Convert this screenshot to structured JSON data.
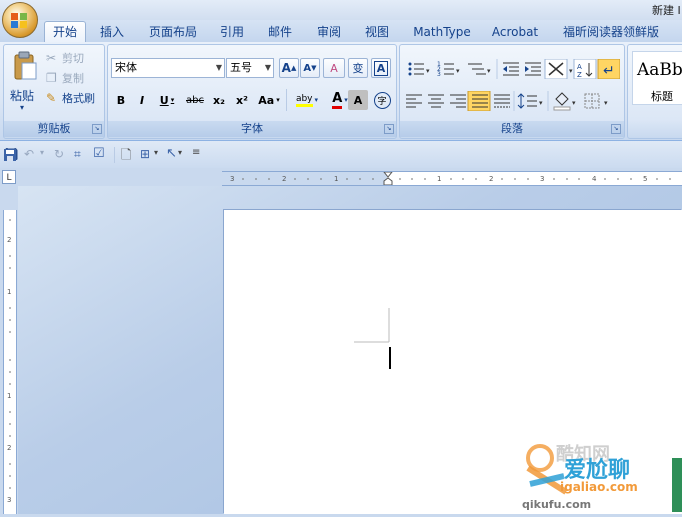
{
  "window": {
    "title": "新建 I"
  },
  "tabs": [
    {
      "label": "开始",
      "active": true
    },
    {
      "label": "插入"
    },
    {
      "label": "页面布局"
    },
    {
      "label": "引用"
    },
    {
      "label": "邮件"
    },
    {
      "label": "审阅"
    },
    {
      "label": "视图"
    },
    {
      "label": "MathType"
    },
    {
      "label": "Acrobat"
    },
    {
      "label": "福昕阅读器领鲜版"
    }
  ],
  "clipboard": {
    "group_label": "剪贴板",
    "paste_label": "粘贴",
    "cut_label": "剪切",
    "copy_label": "复制",
    "format_painter_label": "格式刷"
  },
  "font": {
    "group_label": "字体",
    "font_name": "宋体",
    "font_size": "五号",
    "grow": "A",
    "shrink": "A",
    "clear": "A",
    "phonetic": "变",
    "border_char": "A",
    "bold": "B",
    "italic": "I",
    "underline": "U",
    "strike": "abc",
    "subscript": "x₂",
    "superscript": "x²",
    "case": "Aa",
    "highlight": "aby",
    "font_color": "A",
    "shading": "A",
    "enclose": "字"
  },
  "paragraph": {
    "group_label": "段落"
  },
  "styles": {
    "preview": "AaBb",
    "style_name": "标题"
  },
  "colors": {
    "accent": "#15428b",
    "highlight_yellow": "#ffff00",
    "font_red": "#e00000"
  },
  "watermark": {
    "main": "爱尬聊",
    "sub": "igaliao.com",
    "behind": "酷知网",
    "bottom": "qikufu.com"
  }
}
